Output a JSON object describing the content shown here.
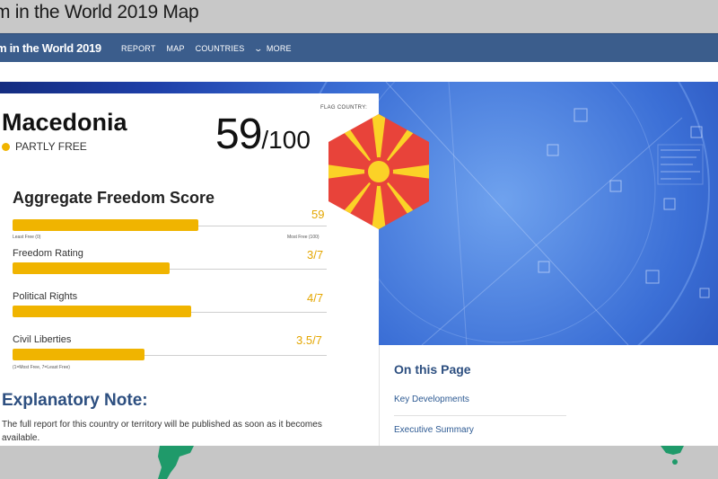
{
  "window": {
    "title": "m in the World 2019 Map"
  },
  "navbar": {
    "brand": "m in the World 2019",
    "items": [
      "REPORT",
      "MAP",
      "COUNTRIES",
      "MORE"
    ]
  },
  "country": {
    "name": "Macedonia",
    "status": "PARTLY FREE",
    "score": "59",
    "score_max": "/100",
    "flag_label": "FLAG COUNTRY:"
  },
  "aggregate": {
    "title": "Aggregate Freedom Score",
    "value": "59",
    "fraction": 0.59,
    "min_label": "Least Free (0)",
    "max_label": "Most Free (100)"
  },
  "metrics": [
    {
      "label": "Freedom Rating",
      "value": "3/7",
      "fraction": 0.5
    },
    {
      "label": "Political Rights",
      "value": "4/7",
      "fraction": 0.57
    },
    {
      "label": "Civil Liberties",
      "value": "3.5/7",
      "fraction": 0.42
    }
  ],
  "metrics_note": "(1=Most Free, 7=Least Free)",
  "explanatory": {
    "title": "Explanatory Note:",
    "text": "The full report for this country or territory will be published as soon as it becomes available."
  },
  "on_this_page": {
    "title": "On this Page",
    "links": [
      "Key Developments",
      "Executive Summary"
    ]
  },
  "colors": {
    "navbar": "#3b5d8c",
    "accent_yellow": "#f0b400",
    "heading_blue": "#2d4f80",
    "flag_red": "#e8433a",
    "flag_yellow": "#fbd227"
  }
}
